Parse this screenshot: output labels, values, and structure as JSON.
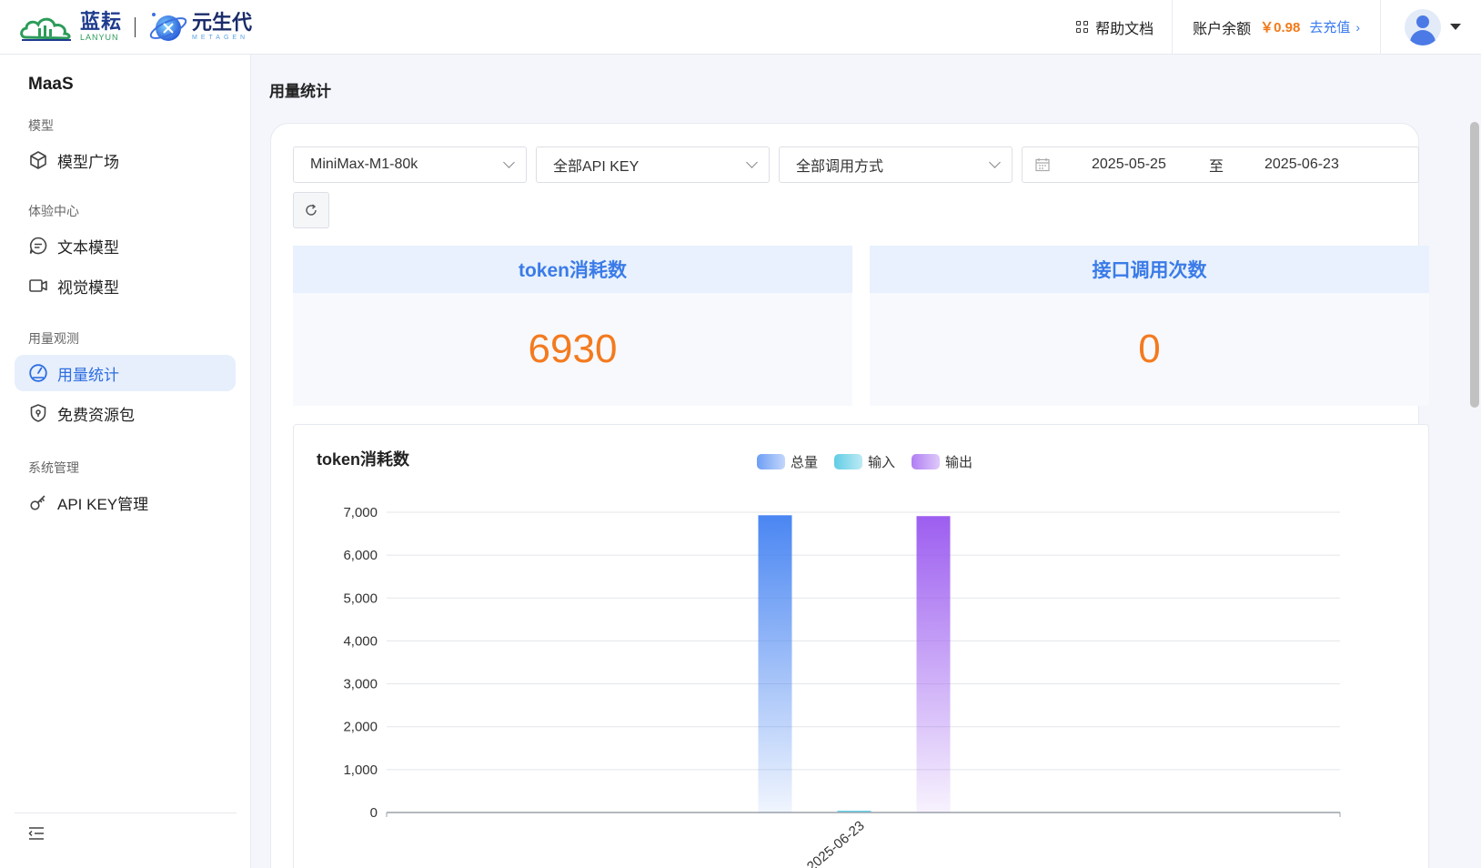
{
  "header": {
    "brand1_cn": "蓝耘",
    "brand1_en": "LANYUN",
    "brand2_cn": "元生代",
    "brand2_en": "METAGEN",
    "help_doc": "帮助文档",
    "balance_label": "账户余额",
    "balance_amount": "￥0.98",
    "recharge": "去充值"
  },
  "sidebar": {
    "title": "MaaS",
    "groups": [
      {
        "label": "模型",
        "items": [
          {
            "label": "模型广场",
            "icon": "cube-icon"
          }
        ]
      },
      {
        "label": "体验中心",
        "items": [
          {
            "label": "文本模型",
            "icon": "chat-icon"
          },
          {
            "label": "视觉模型",
            "icon": "video-icon"
          }
        ]
      },
      {
        "label": "用量观测",
        "items": [
          {
            "label": "用量统计",
            "icon": "gauge-icon",
            "active": true
          },
          {
            "label": "免费资源包",
            "icon": "shield-icon"
          }
        ]
      },
      {
        "label": "系统管理",
        "items": [
          {
            "label": "API KEY管理",
            "icon": "key-icon"
          }
        ]
      }
    ]
  },
  "main": {
    "page_title": "用量统计",
    "filters": {
      "model": "MiniMax-M1-80k",
      "api_key": "全部API KEY",
      "call_type": "全部调用方式",
      "date_start": "2025-05-25",
      "date_sep": "至",
      "date_end": "2025-06-23"
    },
    "stats": {
      "token_label": "token消耗数",
      "token_value": "6930",
      "calls_label": "接口调用次数",
      "calls_value": "0"
    }
  },
  "colors": {
    "accent": "#3b7be8",
    "orange": "#f47a1e",
    "total": "#4a86f2",
    "input": "#39c0df",
    "output": "#9d5ef0"
  },
  "chart_data": {
    "type": "bar",
    "title": "token消耗数",
    "categories": [
      "2025-06-23"
    ],
    "series": [
      {
        "name": "总量",
        "values": [
          6930
        ]
      },
      {
        "name": "输入",
        "values": [
          0
        ]
      },
      {
        "name": "输出",
        "values": [
          6910
        ]
      }
    ],
    "ylim": [
      0,
      7000
    ],
    "yticks": [
      "0",
      "1,000",
      "2,000",
      "3,000",
      "4,000",
      "5,000",
      "6,000",
      "7,000"
    ],
    "grid": true,
    "legend": "top-center"
  }
}
